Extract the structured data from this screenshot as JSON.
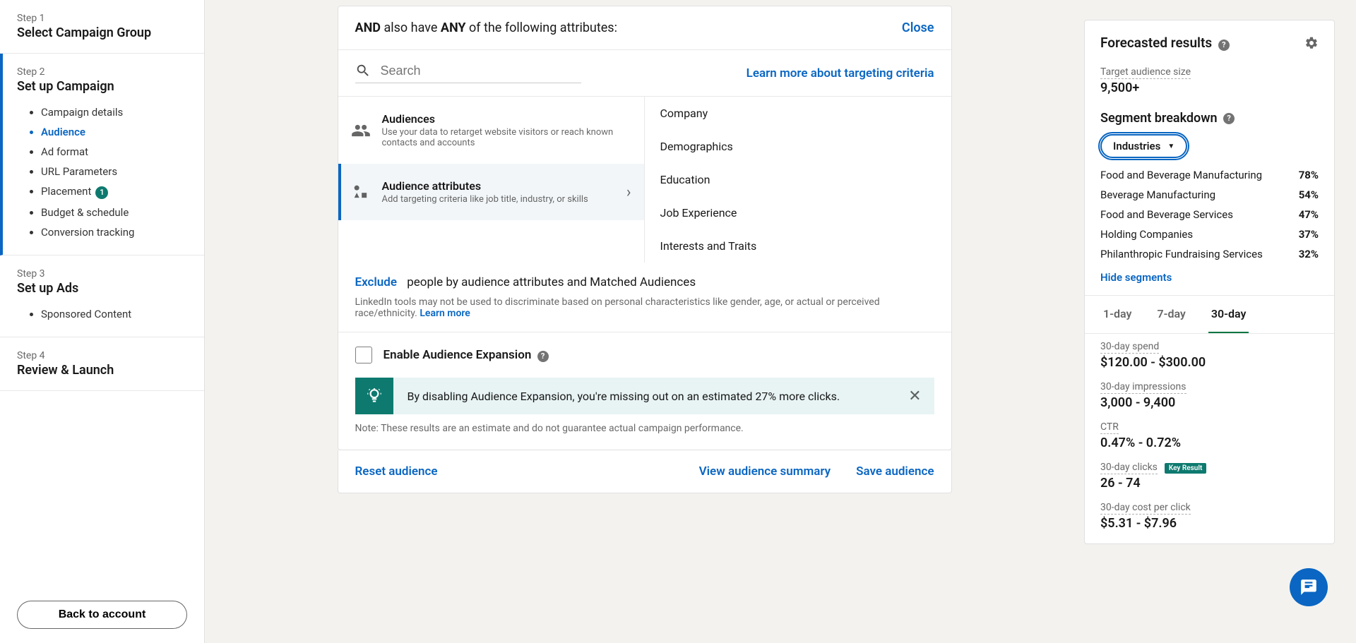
{
  "sidebar": {
    "steps": [
      {
        "label": "Step 1",
        "title": "Select Campaign Group"
      },
      {
        "label": "Step 2",
        "title": "Set up Campaign"
      },
      {
        "label": "Step 3",
        "title": "Set up Ads"
      },
      {
        "label": "Step 4",
        "title": "Review & Launch"
      }
    ],
    "step2_items": [
      "Campaign details",
      "Audience",
      "Ad format",
      "URL Parameters",
      "Placement",
      "Budget & schedule",
      "Conversion tracking"
    ],
    "placement_badge": "1",
    "step3_items": [
      "Sponsored Content"
    ],
    "back_button": "Back to account"
  },
  "attributes_card": {
    "and_label": "AND",
    "any_label": "ANY",
    "have_text": " also have ",
    "suffix_text": " of the following attributes:",
    "close": "Close",
    "search_placeholder": "Search",
    "learn_more_targeting": "Learn more about targeting criteria",
    "audiences_title": "Audiences",
    "audiences_desc": "Use your data to retarget website visitors or reach known contacts and accounts",
    "attributes_title": "Audience attributes",
    "attributes_desc": "Add targeting criteria like job title, industry, or skills",
    "right_items": [
      "Company",
      "Demographics",
      "Education",
      "Job Experience",
      "Interests and Traits"
    ],
    "exclude_link": "Exclude",
    "exclude_text": " people by audience attributes and Matched Audiences",
    "disclaimer": "LinkedIn tools may not be used to discriminate based on personal characteristics like gender, age, or actual or perceived race/ethnicity. ",
    "disclaimer_link": "Learn more",
    "expansion_label": "Enable Audience Expansion",
    "alert_text": "By disabling Audience Expansion, you're missing out on an estimated 27% more clicks.",
    "note_text": "Note: These results are an estimate and do not guarantee actual campaign performance.",
    "reset": "Reset audience",
    "view_summary": "View audience summary",
    "save": "Save audience"
  },
  "forecast": {
    "title": "Forecasted results",
    "target_label": "Target audience size",
    "target_value": "9,500+",
    "segment_title": "Segment breakdown",
    "segment_select": "Industries",
    "segments": [
      {
        "name": "Food and Beverage Manufacturing",
        "pct": "78%"
      },
      {
        "name": "Beverage Manufacturing",
        "pct": "54%"
      },
      {
        "name": "Food and Beverage Services",
        "pct": "47%"
      },
      {
        "name": "Holding Companies",
        "pct": "37%"
      },
      {
        "name": "Philanthropic Fundraising Services",
        "pct": "32%"
      }
    ],
    "hide_segments": "Hide segments",
    "tabs": [
      "1-day",
      "7-day",
      "30-day"
    ],
    "metrics": [
      {
        "label": "30-day spend",
        "value": "$120.00 - $300.00"
      },
      {
        "label": "30-day impressions",
        "value": "3,000 - 9,400"
      },
      {
        "label": "CTR",
        "value": "0.47% - 0.72%"
      },
      {
        "label": "30-day clicks",
        "value": "26 - 74",
        "key": "Key Result"
      },
      {
        "label": "30-day cost per click",
        "value": "$5.31 - $7.96"
      }
    ]
  }
}
